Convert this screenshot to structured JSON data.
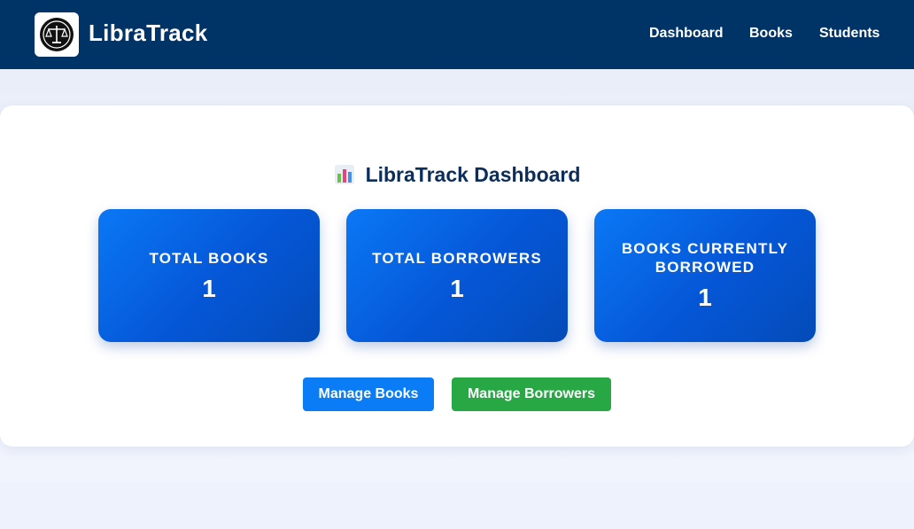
{
  "brand": {
    "name": "LibraTrack",
    "logo_icon": "scales-icon"
  },
  "nav": [
    {
      "label": "Dashboard"
    },
    {
      "label": "Books"
    },
    {
      "label": "Students"
    }
  ],
  "dashboard": {
    "title_icon": "bar-chart-icon",
    "title": "LibraTrack Dashboard",
    "stats": [
      {
        "label": "TOTAL BOOKS",
        "value": "1"
      },
      {
        "label": "TOTAL BORROWERS",
        "value": "1"
      },
      {
        "label": "BOOKS CURRENTLY BORROWED",
        "value": "1"
      }
    ],
    "buttons": {
      "manage_books": "Manage Books",
      "manage_borrowers": "Manage Borrowers"
    }
  },
  "colors": {
    "navbar": "#003366",
    "stat_card": "#0661e0",
    "primary_button": "#0a7cf5",
    "success_button": "#28a745",
    "title_text": "#0b2d5c"
  }
}
